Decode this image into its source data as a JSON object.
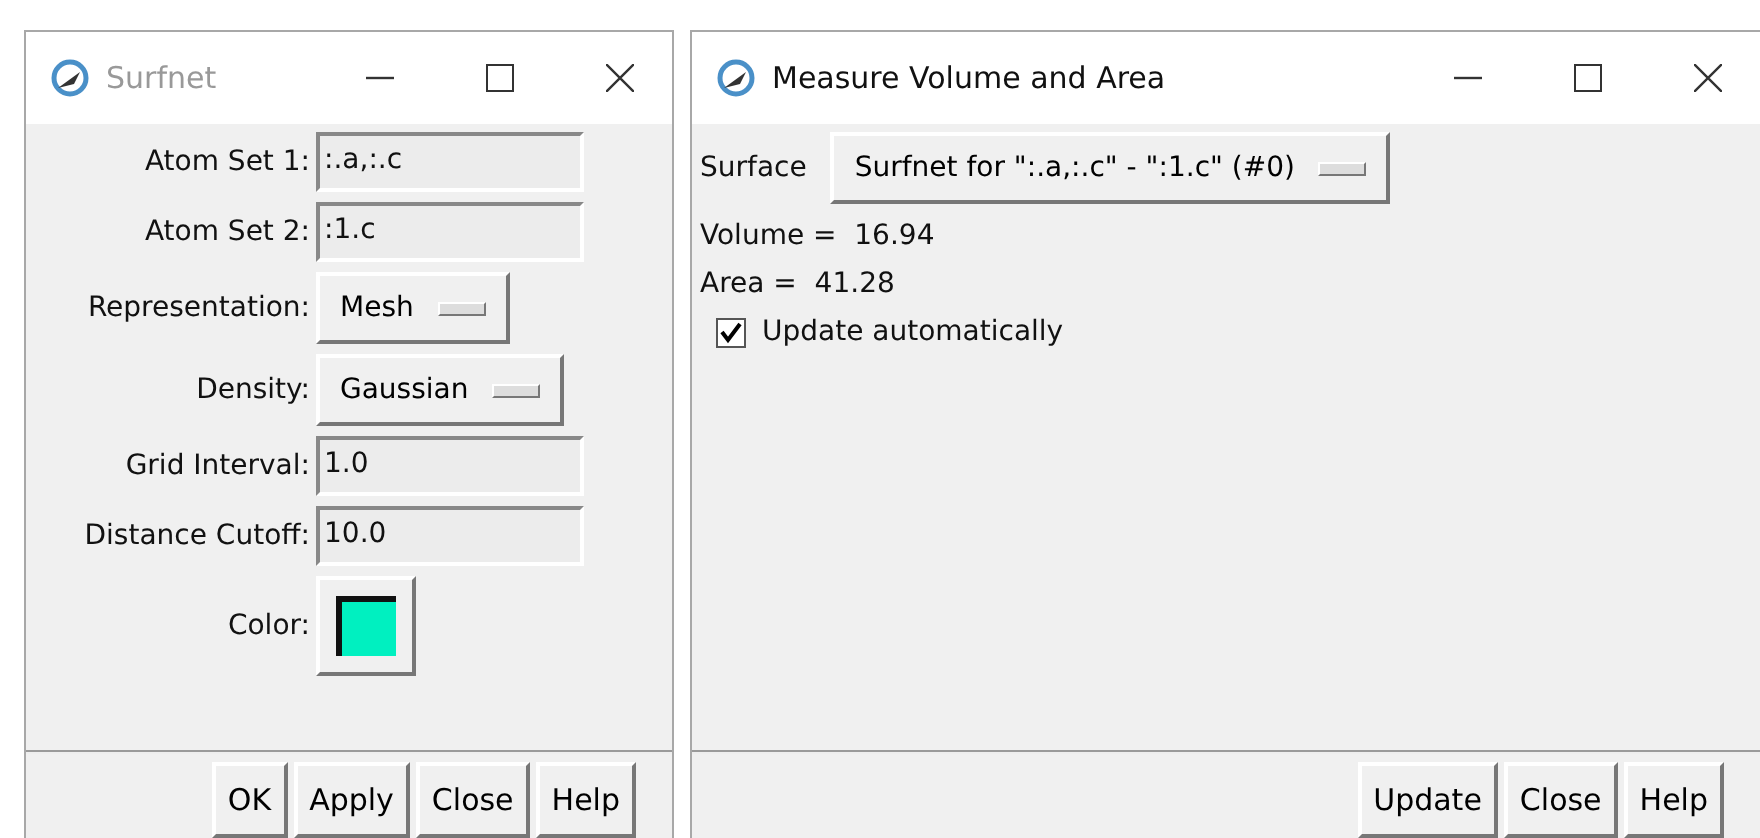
{
  "windows": [
    {
      "kind": "form",
      "title": "Surfnet",
      "active": false,
      "fields": [
        {
          "kind": "text",
          "label": "Atom Set 1:",
          "value": ":.a,:.c"
        },
        {
          "kind": "text",
          "label": "Atom Set 2:",
          "value": ":1.c"
        },
        {
          "kind": "menu",
          "label": "Representation:",
          "value": "Mesh"
        },
        {
          "kind": "menu",
          "label": "Density:",
          "value": "Gaussian"
        },
        {
          "kind": "text",
          "label": "Grid Interval:",
          "value": "1.0"
        },
        {
          "kind": "text",
          "label": "Distance Cutoff:",
          "value": "10.0"
        },
        {
          "kind": "color",
          "label": "Color:",
          "color": "#00f0c0"
        }
      ],
      "buttons": [
        "OK",
        "Apply",
        "Close",
        "Help"
      ]
    },
    {
      "kind": "measure",
      "title": "Measure Volume and Area",
      "active": true,
      "surface": {
        "label": "Surface",
        "value": "Surfnet for \":.a,:.c\" - \":1.c\" (#0)"
      },
      "readouts": [
        "Volume =  16.94",
        "Area =  41.28"
      ],
      "auto_update": {
        "label": "Update automatically",
        "checked": true
      },
      "buttons": [
        "Update",
        "Close",
        "Help"
      ]
    }
  ]
}
